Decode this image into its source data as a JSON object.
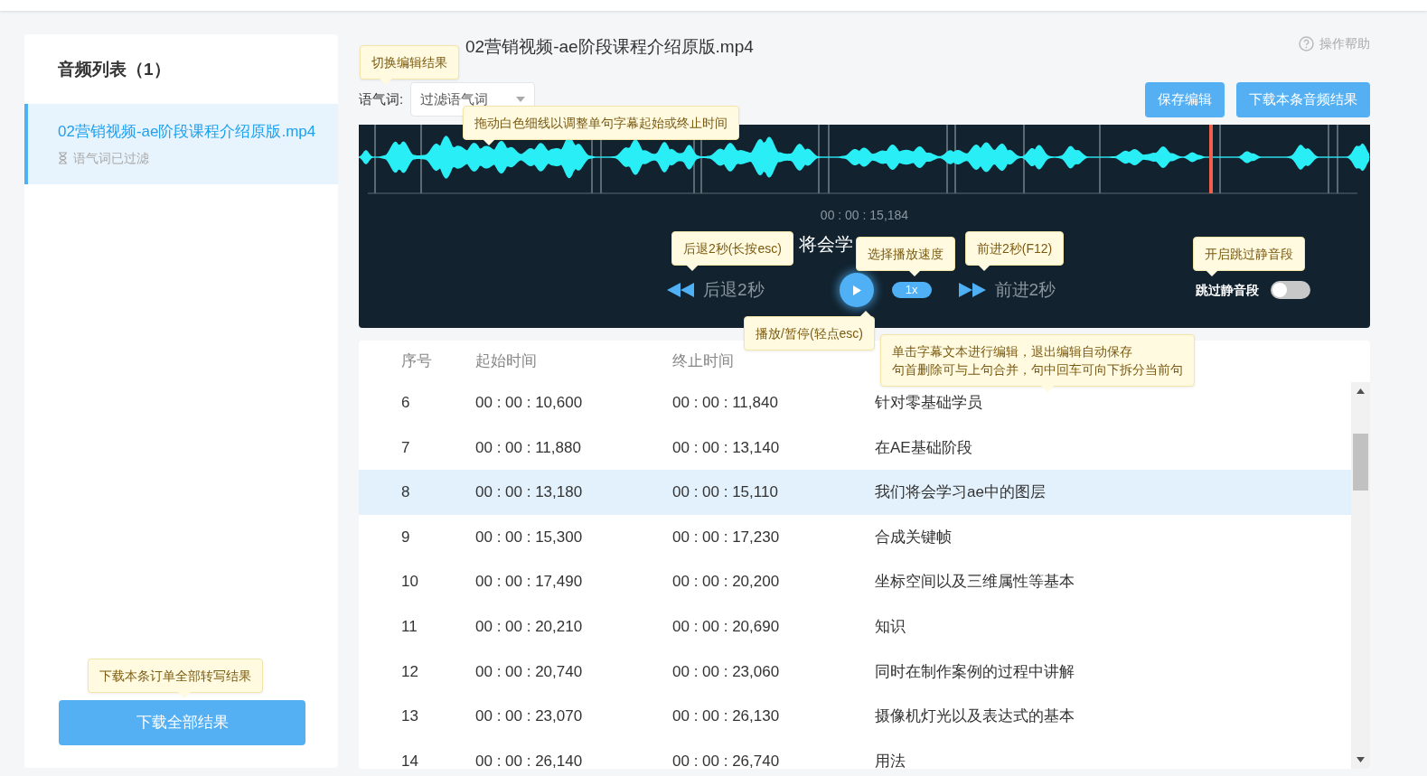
{
  "sidebar": {
    "title": "音频列表（1）",
    "items": [
      {
        "name": "02营销视频-ae阶段课程介绍原版.mp4",
        "status": "语气词已过滤",
        "selected": true
      }
    ],
    "download_all_button": "下载全部结果"
  },
  "header": {
    "title": "02营销视频-ae阶段课程介绍原版.mp4",
    "help_link": "操作帮助"
  },
  "filter": {
    "label": "语气词:",
    "dropdown_value": "过滤语气词"
  },
  "buttons": [
    "保存编辑",
    "下载本条音频结果"
  ],
  "player": {
    "time": "00 : 00 : 15,184",
    "subtitle": "将会学",
    "back_label": "后退2秒",
    "speed": "1x",
    "forward_label": "前进2秒",
    "skip_silence": {
      "label": "跳过静音段",
      "on": false
    }
  },
  "table": {
    "columns": [
      "序号",
      "起始时间",
      "终止时间"
    ],
    "rows": [
      {
        "index": "6",
        "start": "00 : 00 : 10,600",
        "end": "00 : 00 : 11,840",
        "text": "针对零基础学员",
        "selected": false
      },
      {
        "index": "7",
        "start": "00 : 00 : 11,880",
        "end": "00 : 00 : 13,140",
        "text": "在AE基础阶段",
        "selected": false
      },
      {
        "index": "8",
        "start": "00 : 00 : 13,180",
        "end": "00 : 00 : 15,110",
        "text": "我们将会学习ae中的图层",
        "selected": true
      },
      {
        "index": "9",
        "start": "00 : 00 : 15,300",
        "end": "00 : 00 : 17,230",
        "text": "合成关键帧",
        "selected": false
      },
      {
        "index": "10",
        "start": "00 : 00 : 17,490",
        "end": "00 : 00 : 20,200",
        "text": "坐标空间以及三维属性等基本",
        "selected": false
      },
      {
        "index": "11",
        "start": "00 : 00 : 20,210",
        "end": "00 : 00 : 20,690",
        "text": "知识",
        "selected": false
      },
      {
        "index": "12",
        "start": "00 : 00 : 20,740",
        "end": "00 : 00 : 23,060",
        "text": "同时在制作案例的过程中讲解",
        "selected": false
      },
      {
        "index": "13",
        "start": "00 : 00 : 23,070",
        "end": "00 : 00 : 26,130",
        "text": "摄像机灯光以及表达式的基本",
        "selected": false
      },
      {
        "index": "14",
        "start": "00 : 00 : 26,140",
        "end": "00 : 00 : 26,740",
        "text": "用法",
        "selected": false
      }
    ]
  },
  "tooltips": [
    {
      "text": "切换编辑结果"
    },
    {
      "text": "拖动白色细线以调整单句字幕起始或终止时间"
    },
    {
      "text": "后退2秒(长按esc)"
    },
    {
      "text": "选择播放速度"
    },
    {
      "text": "前进2秒(F12)"
    },
    {
      "text": "开启跳过静音段"
    },
    {
      "text": "播放/暂停(轻点esc)"
    },
    {
      "lines": [
        "单击字幕文本进行编辑，退出编辑自动保存",
        "句首删除可与上句合并，句中回车可向下拆分当前句"
      ]
    },
    {
      "text": "下载本条订单全部转写结果"
    }
  ]
}
